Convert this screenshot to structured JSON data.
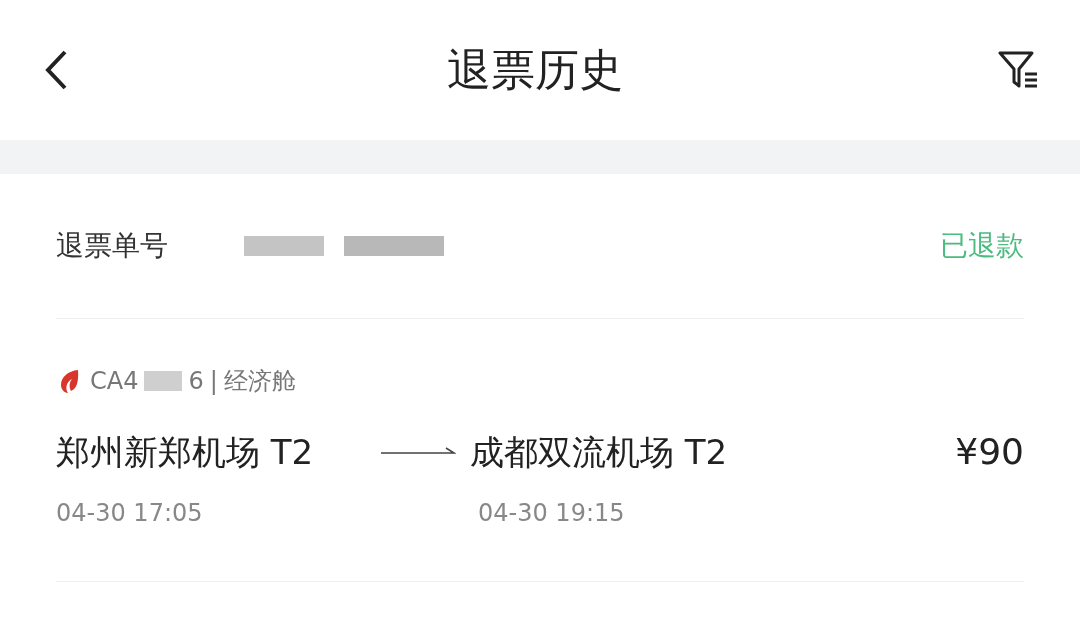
{
  "header": {
    "title": "退票历史"
  },
  "refund": {
    "order_label": "退票单号",
    "status": "已退款"
  },
  "flight": {
    "number_start": "CA4",
    "number_end": "6",
    "separator": "|",
    "cabin": "经济舱"
  },
  "route": {
    "departure": "郑州新郑机场 T2",
    "arrival": "成都双流机场 T2",
    "price": "¥90",
    "departure_time": "04-30 17:05",
    "arrival_time": "04-30 19:15"
  }
}
